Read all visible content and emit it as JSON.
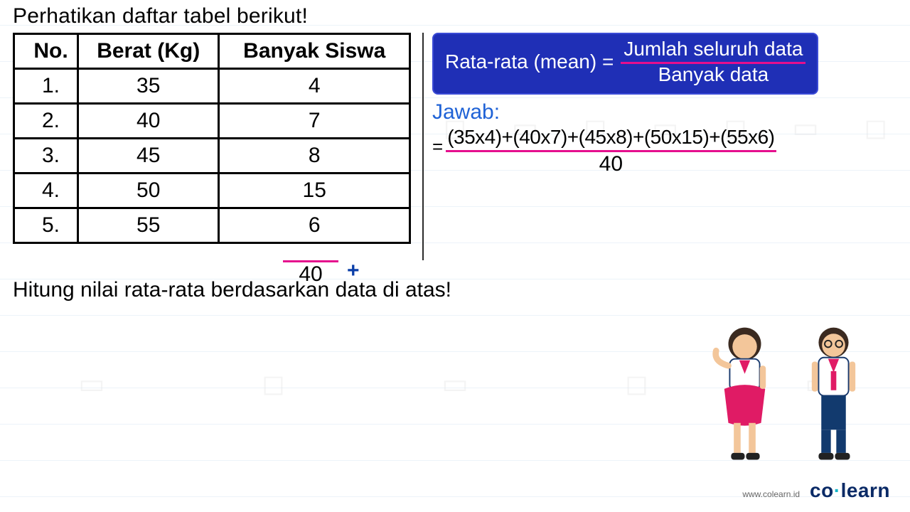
{
  "instr1": "Perhatikan daftar tabel berikut!",
  "table": {
    "headers": [
      "No.",
      "Berat (Kg)",
      "Banyak Siswa"
    ],
    "rows": [
      [
        "1.",
        "35",
        "4"
      ],
      [
        "2.",
        "40",
        "7"
      ],
      [
        "3.",
        "45",
        "8"
      ],
      [
        "4.",
        "50",
        "15"
      ],
      [
        "5.",
        "55",
        "6"
      ]
    ]
  },
  "sum_plus": "+",
  "sum_total": "40",
  "formula": {
    "lhs": "Rata-rata (mean) =",
    "numerator": "Jumlah seluruh data",
    "denominator": "Banyak data"
  },
  "jawab_label": "Jawab:",
  "calc": {
    "eq": "=",
    "numerator": "(35x4)+(40x7)+(45x8)+(50x15)+(55x6)",
    "denominator": "40"
  },
  "instr2": "Hitung nilai rata-rata berdasarkan data di atas!",
  "footer": {
    "url": "www.colearn.id",
    "brand_pre": "co",
    "brand_dot": "·",
    "brand_post": "learn"
  },
  "chart_data": {
    "type": "table",
    "title": "Berat badan siswa",
    "columns": [
      "No.",
      "Berat (Kg)",
      "Banyak Siswa"
    ],
    "rows": [
      {
        "no": 1,
        "berat_kg": 35,
        "banyak_siswa": 4
      },
      {
        "no": 2,
        "berat_kg": 40,
        "banyak_siswa": 7
      },
      {
        "no": 3,
        "berat_kg": 45,
        "banyak_siswa": 8
      },
      {
        "no": 4,
        "berat_kg": 50,
        "banyak_siswa": 15
      },
      {
        "no": 5,
        "berat_kg": 55,
        "banyak_siswa": 6
      }
    ],
    "total_siswa": 40
  }
}
